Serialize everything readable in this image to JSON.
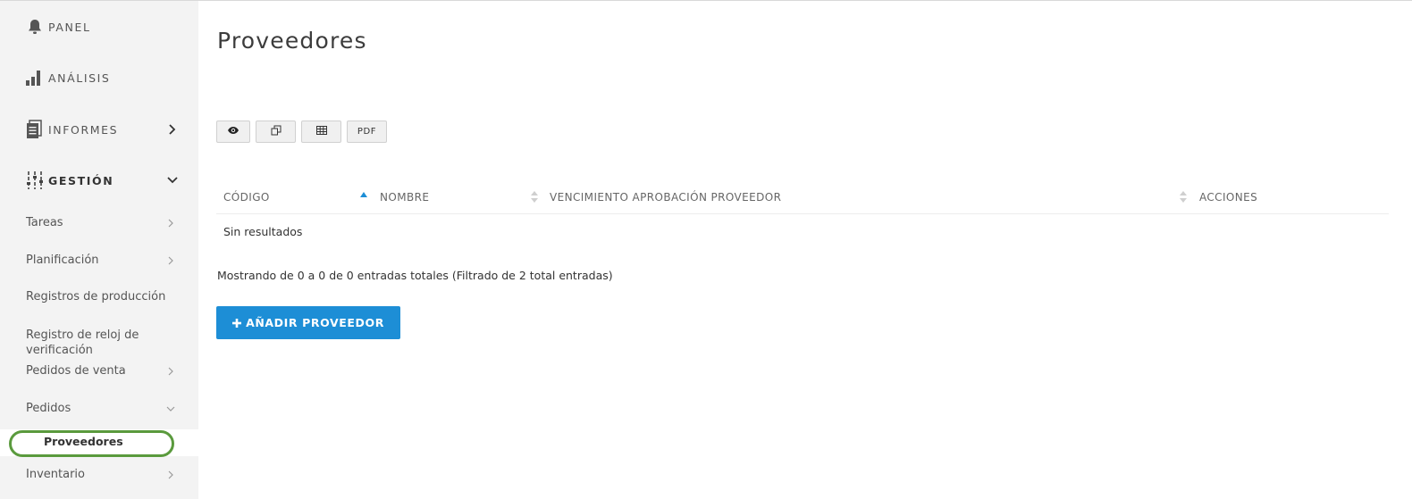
{
  "sidebar": {
    "main": [
      {
        "label": "PANEL",
        "icon": "bell-icon"
      },
      {
        "label": "ANÁLISIS",
        "icon": "bar-chart-icon"
      },
      {
        "label": "INFORMES",
        "icon": "document-icon",
        "chevron": "right"
      },
      {
        "label": "GESTIÓN",
        "icon": "sliders-icon",
        "chevron": "down"
      }
    ],
    "sub": [
      {
        "label": "Tareas",
        "chevron": "right"
      },
      {
        "label": "Planificación",
        "chevron": "right"
      },
      {
        "label": "Registros de producción"
      },
      {
        "label": "Registro de reloj de verificación"
      },
      {
        "label": "Pedidos de venta",
        "chevron": "right"
      },
      {
        "label": "Pedidos",
        "chevron": "down"
      }
    ],
    "active": {
      "label": "Proveedores"
    },
    "after": [
      {
        "label": "Inventario",
        "chevron": "right"
      }
    ]
  },
  "page": {
    "title": "Proveedores"
  },
  "toolbar": {
    "buttons": [
      {
        "icon": "eye-icon"
      },
      {
        "icon": "copy-icon"
      },
      {
        "icon": "table-icon"
      },
      {
        "label": "PDF"
      }
    ]
  },
  "table": {
    "columns": [
      "CÓDIGO",
      "NOMBRE",
      "VENCIMIENTO APROBACIÓN PROVEEDOR",
      "ACCIONES"
    ],
    "sorted_column": "CÓDIGO",
    "sort_direction": "asc",
    "empty_text": "Sin resultados",
    "rows": []
  },
  "footer": {
    "info": "Mostrando de 0 a 0 de 0 entradas totales (Filtrado de 2 total entradas)",
    "add_button": "AÑADIR PROVEEDOR"
  },
  "colors": {
    "accent": "#1d8ed6",
    "sidebar_bg": "#f3f3f3",
    "highlight_ring": "#5a9a3d"
  }
}
